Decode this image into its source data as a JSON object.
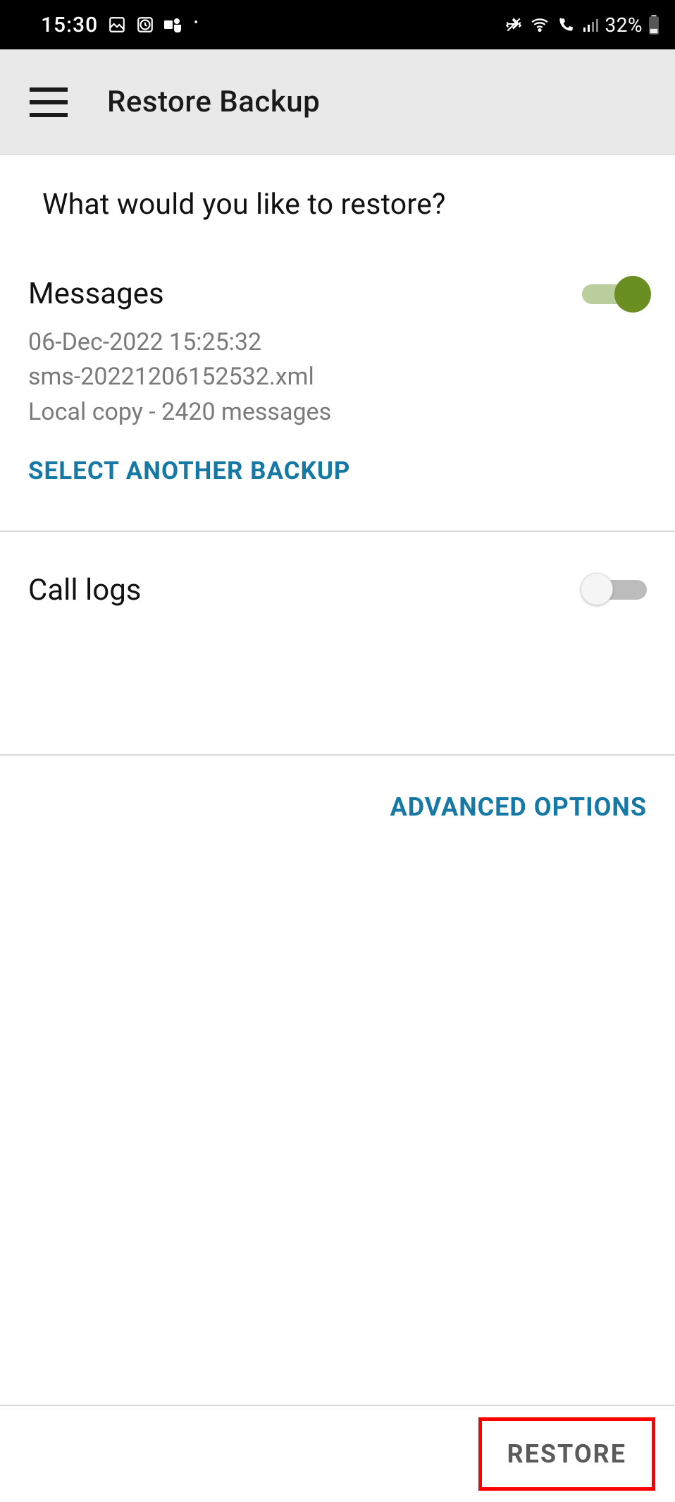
{
  "statusbar": {
    "time": "15:30",
    "battery_text": "32%"
  },
  "appbar": {
    "title": "Restore Backup"
  },
  "main": {
    "prompt": "What would you like to restore?",
    "messages": {
      "title": "Messages",
      "line1": "06-Dec-2022 15:25:32",
      "line2": "sms-20221206152532.xml",
      "line3": "Local copy - 2420 messages",
      "select_another": "SELECT ANOTHER BACKUP",
      "toggle_on": true
    },
    "calllogs": {
      "title": "Call logs",
      "toggle_on": false
    },
    "advanced_label": "ADVANCED OPTIONS"
  },
  "footer": {
    "restore_label": "RESTORE"
  }
}
